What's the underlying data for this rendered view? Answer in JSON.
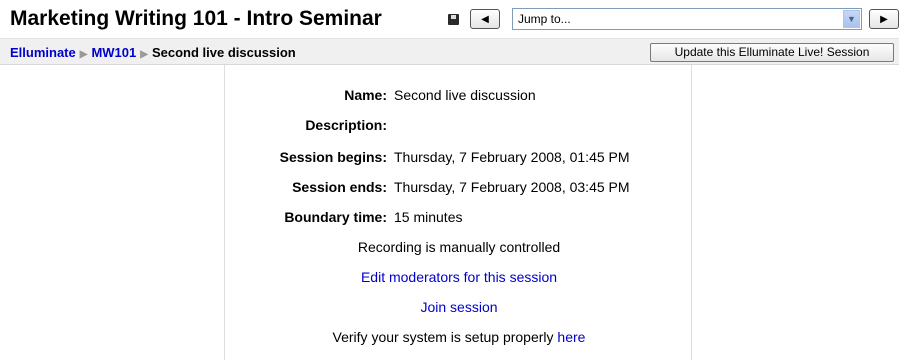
{
  "header": {
    "title": "Marketing Writing 101 - Intro Seminar",
    "jump": {
      "selected": "Jump to..."
    },
    "icons": {
      "save": "floppy-disk-icon",
      "prev": "left-arrow-icon",
      "next": "right-arrow-icon",
      "dropdown": "chevron-down-icon"
    }
  },
  "breadcrumb": {
    "items": [
      "Elluminate",
      "MW101",
      "Second live discussion"
    ]
  },
  "actions": {
    "update_label": "Update this Elluminate Live! Session"
  },
  "session": {
    "fields": [
      {
        "label": "Name:",
        "value": "Second live discussion"
      },
      {
        "label": "Description:",
        "value": ""
      },
      {
        "label": "Session begins:",
        "value": "Thursday, 7 February 2008, 01:45 PM"
      },
      {
        "label": "Session ends:",
        "value": "Thursday, 7 February 2008, 03:45 PM"
      },
      {
        "label": "Boundary time:",
        "value": "15 minutes"
      }
    ],
    "recording": "Recording is manually controlled",
    "edit_moderators": "Edit moderators for this session",
    "join": "Join session",
    "verify_text": "Verify your system is setup properly",
    "verify_link": "here"
  },
  "colors": {
    "link": "#0000cc",
    "navbar_bg": "#f0f0f0"
  }
}
